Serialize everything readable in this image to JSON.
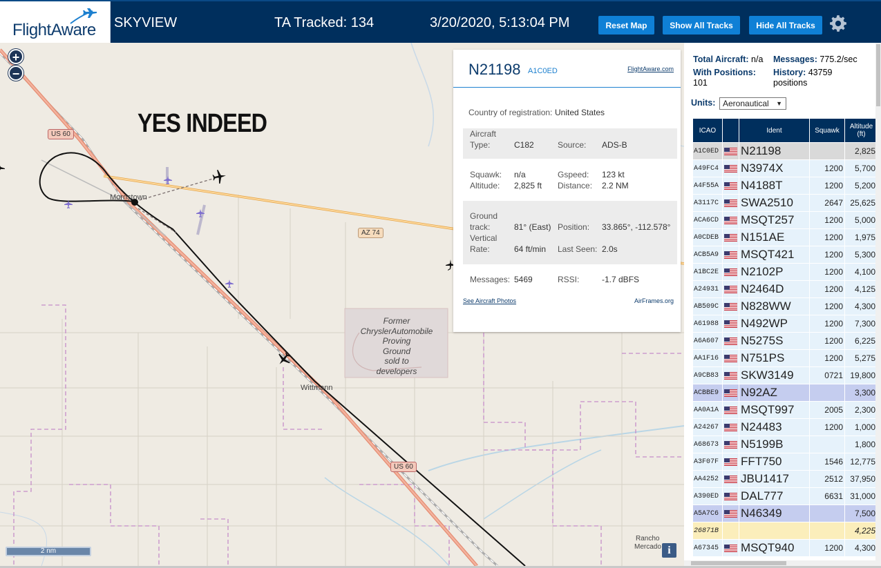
{
  "header": {
    "logo_text": "FlightAware",
    "app_name": "SKYVIEW",
    "tracked": "TA Tracked: 134",
    "datetime": "3/20/2020, 5:13:04 PM",
    "buttons": {
      "reset": "Reset Map",
      "show": "Show All Tracks",
      "hide": "Hide All Tracks"
    }
  },
  "map": {
    "overlay_text": "YES INDEED",
    "places": {
      "morristown": "Morristown",
      "wittmann": "Wittmann",
      "rancho": "Rancho",
      "mercado": "Mercado"
    },
    "roads": {
      "us60_a": "US 60",
      "az74": "AZ 74",
      "us60_b": "US 60"
    },
    "former_lines": [
      "Former",
      "ChryslerAutomobile",
      "Proving",
      "Ground",
      "sold to",
      "developers"
    ],
    "scale": "2 nm",
    "zoom_in": "+",
    "zoom_out": "−",
    "info": "i"
  },
  "popup": {
    "callsign": "N21198",
    "icao": "A1C0ED",
    "fa_link": "FlightAware.com",
    "country_label": "Country of registration:",
    "country": "United States",
    "aircraft_type_label1": "Aircraft",
    "aircraft_type_label2": "Type:",
    "aircraft_type": "C182",
    "source_label": "Source:",
    "source": "ADS-B",
    "squawk_label": "Squawk:",
    "squawk": "n/a",
    "gspeed_label": "Gspeed:",
    "gspeed": "123 kt",
    "altitude_label": "Altitude:",
    "altitude": "2,825 ft",
    "distance_label": "Distance:",
    "distance": "2.2 NM",
    "ground_label1": "Ground",
    "ground_label2": "track:",
    "ground_track": "81° (East)",
    "position_label": "Position:",
    "position": "33.865°, -112.578°",
    "vertical_label1": "Vertical",
    "vertical_label2": "Rate:",
    "vertical_rate": "64 ft/min",
    "last_seen_label": "Last Seen:",
    "last_seen": "2.0s",
    "messages_label": "Messages:",
    "messages": "5469",
    "rssi_label": "RSSI:",
    "rssi": "-1.7 dBFS",
    "photos_link": "See Aircraft Photos",
    "airframes_link": "AirFrames.org"
  },
  "sidebar": {
    "total_label": "Total Aircraft:",
    "total": "n/a",
    "messages_label": "Messages:",
    "messages": "775.2/sec",
    "positions_label": "With Positions:",
    "positions": "101",
    "history_label": "History:",
    "history_line1": "43759",
    "history_line2": "positions",
    "units_label": "Units:",
    "units_value": "Aeronautical",
    "columns": {
      "icao": "ICAO",
      "ident": "Ident",
      "squawk": "Squawk",
      "alt1": "Altitude",
      "alt2": "(ft)"
    },
    "rows": [
      {
        "icao": "A1C0ED",
        "ident": "N21198",
        "squawk": "",
        "alt": "2,825",
        "style": "gray"
      },
      {
        "icao": "A49FC4",
        "ident": "N3974X",
        "squawk": "1200",
        "alt": "5,700",
        "style": "blue"
      },
      {
        "icao": "A4F55A",
        "ident": "N4188T",
        "squawk": "1200",
        "alt": "5,200",
        "style": "blue"
      },
      {
        "icao": "A3117C",
        "ident": "SWA2510",
        "squawk": "2647",
        "alt": "25,625",
        "style": "blue"
      },
      {
        "icao": "ACA6CD",
        "ident": "MSQT257",
        "squawk": "1200",
        "alt": "5,000",
        "style": "blue"
      },
      {
        "icao": "A0CDEB",
        "ident": "N151AE",
        "squawk": "1200",
        "alt": "1,975",
        "style": "blue"
      },
      {
        "icao": "ACB5A9",
        "ident": "MSQT421",
        "squawk": "1200",
        "alt": "5,300",
        "style": "blue"
      },
      {
        "icao": "A1BC2E",
        "ident": "N2102P",
        "squawk": "1200",
        "alt": "4,100",
        "style": "blue"
      },
      {
        "icao": "A24931",
        "ident": "N2464D",
        "squawk": "1200",
        "alt": "4,125",
        "style": "blue"
      },
      {
        "icao": "AB509C",
        "ident": "N828WW",
        "squawk": "1200",
        "alt": "4,300",
        "style": "blue"
      },
      {
        "icao": "A61988",
        "ident": "N492WP",
        "squawk": "1200",
        "alt": "7,300",
        "style": "blue"
      },
      {
        "icao": "A6A607",
        "ident": "N5275S",
        "squawk": "1200",
        "alt": "6,225",
        "style": "blue"
      },
      {
        "icao": "AA1F16",
        "ident": "N751PS",
        "squawk": "1200",
        "alt": "5,275",
        "style": "blue"
      },
      {
        "icao": "A9CB83",
        "ident": "SKW3149",
        "squawk": "0721",
        "alt": "19,800",
        "style": "blue"
      },
      {
        "icao": "ACBBE9",
        "ident": "N92AZ",
        "squawk": "",
        "alt": "3,300",
        "style": "sel"
      },
      {
        "icao": "AA0A1A",
        "ident": "MSQT997",
        "squawk": "2005",
        "alt": "2,300",
        "style": "blue"
      },
      {
        "icao": "A24267",
        "ident": "N24483",
        "squawk": "1200",
        "alt": "1,000",
        "style": "blue"
      },
      {
        "icao": "A68673",
        "ident": "N5199B",
        "squawk": "",
        "alt": "1,800",
        "style": "blue"
      },
      {
        "icao": "A3F07F",
        "ident": "FFT750",
        "squawk": "1546",
        "alt": "12,775",
        "style": "blue"
      },
      {
        "icao": "AA4252",
        "ident": "JBU1417",
        "squawk": "2512",
        "alt": "37,950",
        "style": "blue"
      },
      {
        "icao": "A390ED",
        "ident": "DAL777",
        "squawk": "6631",
        "alt": "31,000",
        "style": "blue"
      },
      {
        "icao": "A5A7C6",
        "ident": "N46349",
        "squawk": "",
        "alt": "7,500",
        "style": "sel"
      },
      {
        "icao": "26871B",
        "ident": "",
        "squawk": "",
        "alt": "4,225",
        "style": "yel"
      },
      {
        "icao": "A67345",
        "ident": "MSQT940",
        "squawk": "1200",
        "alt": "4,300",
        "style": "blue"
      }
    ]
  },
  "colors": {
    "header_bg": "#002f5d",
    "button": "#0f80d6",
    "accent": "#1d80cf",
    "row_blue": "#e6f2fb",
    "row_selected": "#c5cdef"
  }
}
